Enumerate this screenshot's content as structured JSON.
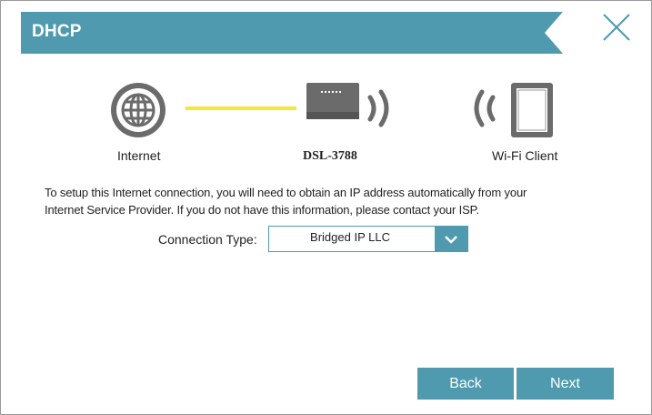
{
  "dialog": {
    "title": "DHCP",
    "accent_color": "#4f9aae",
    "line_color": "#f5e63a"
  },
  "diagram": {
    "internet_label": "Internet",
    "router_label": "DSL-3788",
    "client_label": "Wi-Fi Client",
    "icons": [
      "globe-icon",
      "router-icon",
      "wifi-wave-icon",
      "tablet-icon"
    ]
  },
  "description": {
    "line1": "To setup this Internet connection, you will need to obtain an IP address automatically from your",
    "line2": "Internet Service Provider. If you do not have this information, please contact your ISP."
  },
  "connection_type": {
    "label": "Connection Type:",
    "value": "Bridged IP LLC"
  },
  "buttons": {
    "back": "Back",
    "next": "Next"
  }
}
